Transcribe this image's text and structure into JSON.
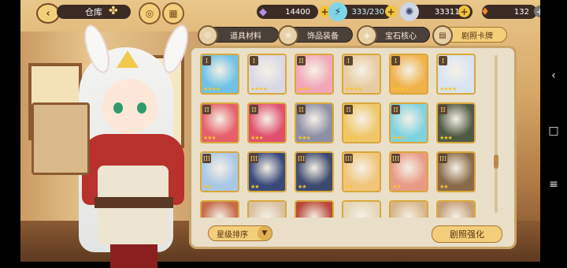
{
  "topbar": {
    "title": "仓库",
    "gems": "14400",
    "stamina": "333/230",
    "coins": "333111",
    "carrots": "132"
  },
  "tabs": [
    {
      "label": "道具材料",
      "icon": "gear-icon",
      "active": false
    },
    {
      "label": "饰品装备",
      "icon": "hat-icon",
      "active": false
    },
    {
      "label": "宝石核心",
      "icon": "gem-icon",
      "active": false
    },
    {
      "label": "剧照卡牌",
      "icon": "card-icon",
      "active": true
    }
  ],
  "cards": [
    {
      "rank": "I",
      "stars": "★★★★",
      "color": "#6fc2e6"
    },
    {
      "rank": "I",
      "stars": "★★★★",
      "color": "#d9d9e6"
    },
    {
      "rank": "II",
      "stars": "★★★",
      "color": "#f2a7b8"
    },
    {
      "rank": "I",
      "stars": "★★★★",
      "color": "#e8cba0"
    },
    {
      "rank": "I",
      "stars": "★★★★",
      "color": "#f0b24c"
    },
    {
      "rank": "I",
      "stars": "★★★★",
      "color": "#d8e4f2"
    },
    {
      "rank": "II",
      "stars": "★★★",
      "color": "#e5606a"
    },
    {
      "rank": "II",
      "stars": "★★★",
      "color": "#e0506e"
    },
    {
      "rank": "II",
      "stars": "★★★",
      "color": "#8c8fa6"
    },
    {
      "rank": "II",
      "stars": "★★★",
      "color": "#f0c86a"
    },
    {
      "rank": "II",
      "stars": "★★★",
      "color": "#7fd3e0"
    },
    {
      "rank": "II",
      "stars": "★★★",
      "color": "#4f5a44"
    },
    {
      "rank": "III",
      "stars": "★★",
      "color": "#a9c8e6"
    },
    {
      "rank": "III",
      "stars": "★★",
      "color": "#384a7a"
    },
    {
      "rank": "III",
      "stars": "★★",
      "color": "#3c4a6e"
    },
    {
      "rank": "III",
      "stars": "★★",
      "color": "#f1c57a"
    },
    {
      "rank": "III",
      "stars": "★★",
      "color": "#e99a86"
    },
    {
      "rank": "III",
      "stars": "★★",
      "color": "#8a6a48"
    },
    {
      "rank": "",
      "stars": "",
      "color": "#c66a4a"
    },
    {
      "rank": "",
      "stars": "",
      "color": "#d8c0a0"
    },
    {
      "rank": "",
      "stars": "",
      "color": "#b94a3a"
    },
    {
      "rank": "",
      "stars": "",
      "color": "#e4d6b6"
    },
    {
      "rank": "",
      "stars": "",
      "color": "#d7b58a"
    },
    {
      "rank": "",
      "stars": "",
      "color": "#c59e78"
    }
  ],
  "footer": {
    "sort_label": "星级排序",
    "enhance_label": "剧照强化"
  },
  "android_nav": {
    "back": "‹",
    "home": "□",
    "menu": "≡"
  }
}
